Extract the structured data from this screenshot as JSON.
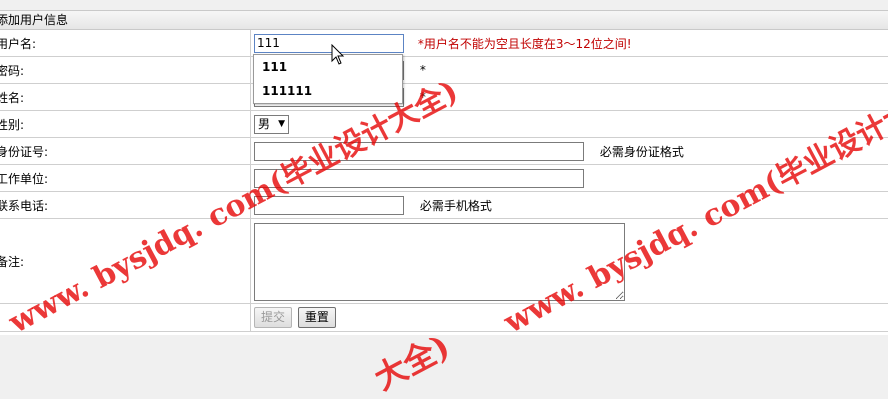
{
  "header": {
    "title": "添加用户信息"
  },
  "form": {
    "username": {
      "label": "用户名:",
      "value": "111",
      "error": "*用户名不能为空且长度在3～12位之间!"
    },
    "password": {
      "label": "密码:",
      "required": "*"
    },
    "realname": {
      "label": "姓名:",
      "required": "*"
    },
    "gender": {
      "label": "性别:",
      "selected": "男",
      "arrow": "▼"
    },
    "idcard": {
      "label": "身份证号:",
      "hint": "必需身份证格式"
    },
    "workunit": {
      "label": "工作单位:"
    },
    "phone": {
      "label": "联系电话:",
      "hint": "必需手机格式"
    },
    "remark": {
      "label": "备注:"
    }
  },
  "autocomplete": {
    "items": [
      "111",
      "111111"
    ]
  },
  "buttons": {
    "submit": "提交",
    "reset": "重置"
  },
  "watermark": {
    "text1": "www. bysjdq. com(毕业设计大全)",
    "text2": "www. bysjdq. com(毕业设计大",
    "text3": "大全)"
  }
}
